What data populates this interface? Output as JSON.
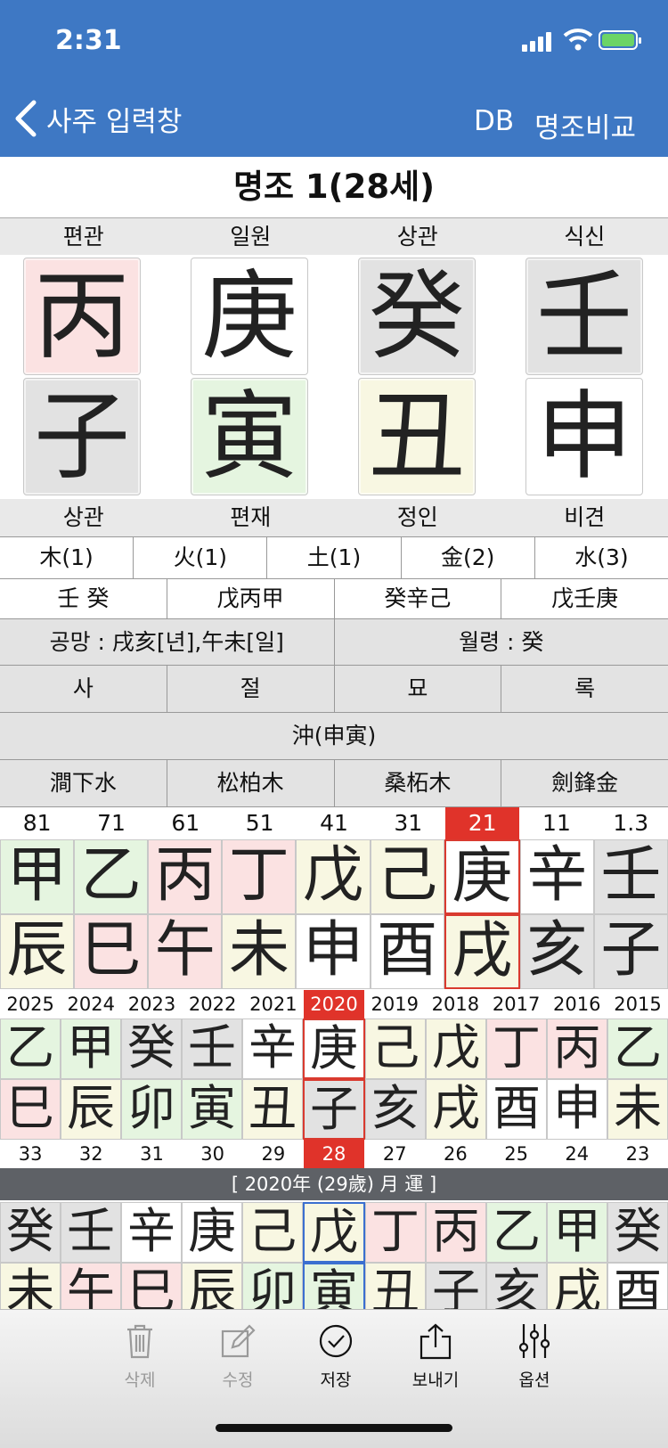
{
  "status": {
    "time": "2:31"
  },
  "nav": {
    "back_label": "사주 입력창",
    "db_label": "DB",
    "compare_label": "명조비교"
  },
  "title": "명조 1(28세)",
  "top_labels": [
    "편관",
    "일원",
    "상관",
    "식신"
  ],
  "stems": [
    {
      "char": "丙",
      "color": "red"
    },
    {
      "char": "庚",
      "color": "white"
    },
    {
      "char": "癸",
      "color": "gray"
    },
    {
      "char": "壬",
      "color": "gray"
    }
  ],
  "branches": [
    {
      "char": "子",
      "color": "gray"
    },
    {
      "char": "寅",
      "color": "green"
    },
    {
      "char": "丑",
      "color": "yellow"
    },
    {
      "char": "申",
      "color": "white"
    }
  ],
  "bottom_labels": [
    "상관",
    "편재",
    "정인",
    "비견"
  ],
  "elements": [
    "木(1)",
    "火(1)",
    "土(1)",
    "金(2)",
    "水(3)"
  ],
  "hidden_stems": [
    "壬 癸",
    "戊丙甲",
    "癸辛己",
    "戊壬庚"
  ],
  "gongmang": "공망 : 戌亥[년],午未[일]",
  "wolryeong": "월령 : 癸",
  "stages": [
    "사",
    "절",
    "묘",
    "록"
  ],
  "clash": "沖(申寅)",
  "napeum": [
    "澗下水",
    "松柏木",
    "桑柘木",
    "劍鋒金"
  ],
  "daewoon": {
    "ages": [
      "81",
      "71",
      "61",
      "51",
      "41",
      "31",
      "21",
      "11",
      "1.3"
    ],
    "selected_index": 6,
    "stems": [
      {
        "char": "甲",
        "color": "green"
      },
      {
        "char": "乙",
        "color": "green"
      },
      {
        "char": "丙",
        "color": "red"
      },
      {
        "char": "丁",
        "color": "red"
      },
      {
        "char": "戊",
        "color": "yellow"
      },
      {
        "char": "己",
        "color": "yellow"
      },
      {
        "char": "庚",
        "color": "white"
      },
      {
        "char": "辛",
        "color": "white"
      },
      {
        "char": "壬",
        "color": "gray"
      }
    ],
    "branches": [
      {
        "char": "辰",
        "color": "yellow"
      },
      {
        "char": "巳",
        "color": "red"
      },
      {
        "char": "午",
        "color": "red"
      },
      {
        "char": "未",
        "color": "yellow"
      },
      {
        "char": "申",
        "color": "white"
      },
      {
        "char": "酉",
        "color": "white"
      },
      {
        "char": "戌",
        "color": "yellow"
      },
      {
        "char": "亥",
        "color": "gray"
      },
      {
        "char": "子",
        "color": "gray"
      }
    ]
  },
  "sewoon": {
    "years": [
      "2025",
      "2024",
      "2023",
      "2022",
      "2021",
      "2020",
      "2019",
      "2018",
      "2017",
      "2016",
      "2015"
    ],
    "ages": [
      "33",
      "32",
      "31",
      "30",
      "29",
      "28",
      "27",
      "26",
      "25",
      "24",
      "23"
    ],
    "selected_index": 5,
    "stems": [
      {
        "char": "乙",
        "color": "green"
      },
      {
        "char": "甲",
        "color": "green"
      },
      {
        "char": "癸",
        "color": "gray"
      },
      {
        "char": "壬",
        "color": "gray"
      },
      {
        "char": "辛",
        "color": "white"
      },
      {
        "char": "庚",
        "color": "white"
      },
      {
        "char": "己",
        "color": "yellow"
      },
      {
        "char": "戊",
        "color": "yellow"
      },
      {
        "char": "丁",
        "color": "red"
      },
      {
        "char": "丙",
        "color": "red"
      },
      {
        "char": "乙",
        "color": "green"
      }
    ],
    "branches": [
      {
        "char": "巳",
        "color": "red"
      },
      {
        "char": "辰",
        "color": "yellow"
      },
      {
        "char": "卯",
        "color": "green"
      },
      {
        "char": "寅",
        "color": "green"
      },
      {
        "char": "丑",
        "color": "yellow"
      },
      {
        "char": "子",
        "color": "gray"
      },
      {
        "char": "亥",
        "color": "gray"
      },
      {
        "char": "戌",
        "color": "yellow"
      },
      {
        "char": "酉",
        "color": "white"
      },
      {
        "char": "申",
        "color": "white"
      },
      {
        "char": "未",
        "color": "yellow"
      }
    ]
  },
  "wolwoon": {
    "title": "[ 2020年 (29歲) 月 運 ]",
    "selected_index": 5,
    "stems": [
      {
        "char": "癸",
        "color": "gray"
      },
      {
        "char": "壬",
        "color": "gray"
      },
      {
        "char": "辛",
        "color": "white"
      },
      {
        "char": "庚",
        "color": "white"
      },
      {
        "char": "己",
        "color": "yellow"
      },
      {
        "char": "戊",
        "color": "yellow"
      },
      {
        "char": "丁",
        "color": "red"
      },
      {
        "char": "丙",
        "color": "red"
      },
      {
        "char": "乙",
        "color": "green"
      },
      {
        "char": "甲",
        "color": "green"
      },
      {
        "char": "癸",
        "color": "gray"
      }
    ],
    "branches": [
      {
        "char": "未",
        "color": "yellow"
      },
      {
        "char": "午",
        "color": "red"
      },
      {
        "char": "巳",
        "color": "red"
      },
      {
        "char": "辰",
        "color": "yellow"
      },
      {
        "char": "卯",
        "color": "green"
      },
      {
        "char": "寅",
        "color": "green"
      },
      {
        "char": "丑",
        "color": "yellow"
      },
      {
        "char": "子",
        "color": "gray"
      },
      {
        "char": "亥",
        "color": "gray"
      },
      {
        "char": "戌",
        "color": "yellow"
      },
      {
        "char": "酉",
        "color": "white"
      }
    ]
  },
  "toolbar": {
    "delete": "삭제",
    "edit": "수정",
    "save": "저장",
    "send": "보내기",
    "options": "옵션",
    "icons": [
      "trash-icon",
      "edit-icon",
      "check-circle-icon",
      "share-icon",
      "sliders-icon"
    ]
  },
  "colors": {
    "nav": "#3e78c4",
    "selected": "#e0332a",
    "month_bar": "#5e6166"
  }
}
